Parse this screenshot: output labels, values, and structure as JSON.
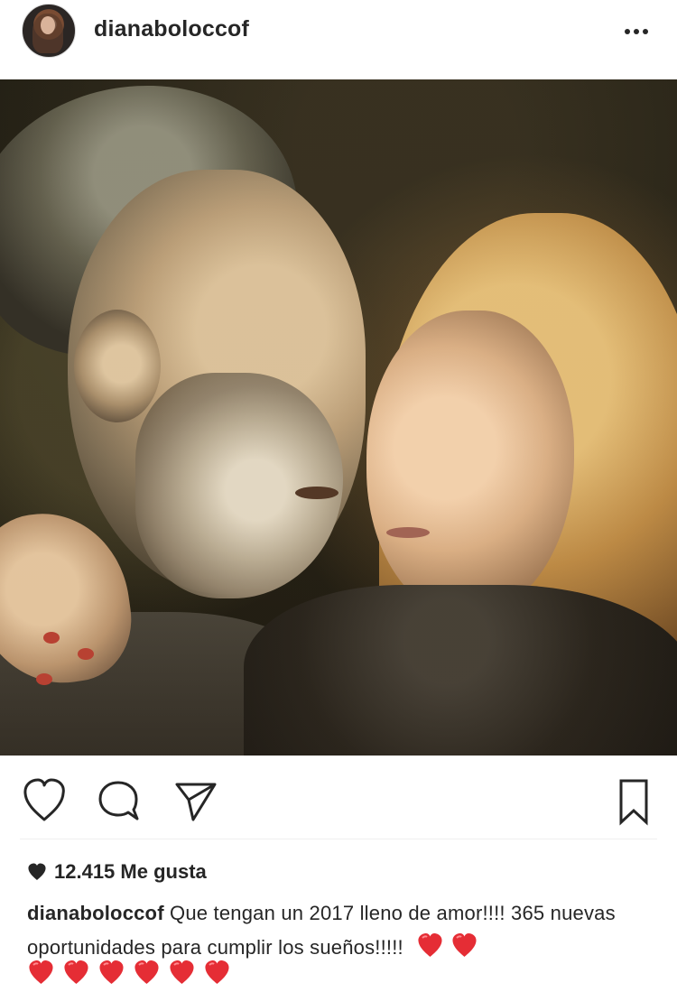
{
  "post": {
    "username": "dianaboloccof",
    "likes_count": "12.415",
    "likes_label": "Me gusta",
    "caption_username": "dianaboloccof",
    "caption_text": "Que tengan un 2017 lleno de amor!!!! 365 nuevas oportunidades para cumplir los sueños!!!!!"
  },
  "icons": {
    "menu": "more-icon",
    "like": "heart-icon",
    "comment": "comment-icon",
    "share": "share-icon",
    "save": "bookmark-icon",
    "likes_indicator": "heart-icon",
    "caption_emoji": "red-heart-icon"
  },
  "colors": {
    "text": "#262626",
    "secondary_border": "#efefef",
    "heart_red": "#ed3a45"
  }
}
